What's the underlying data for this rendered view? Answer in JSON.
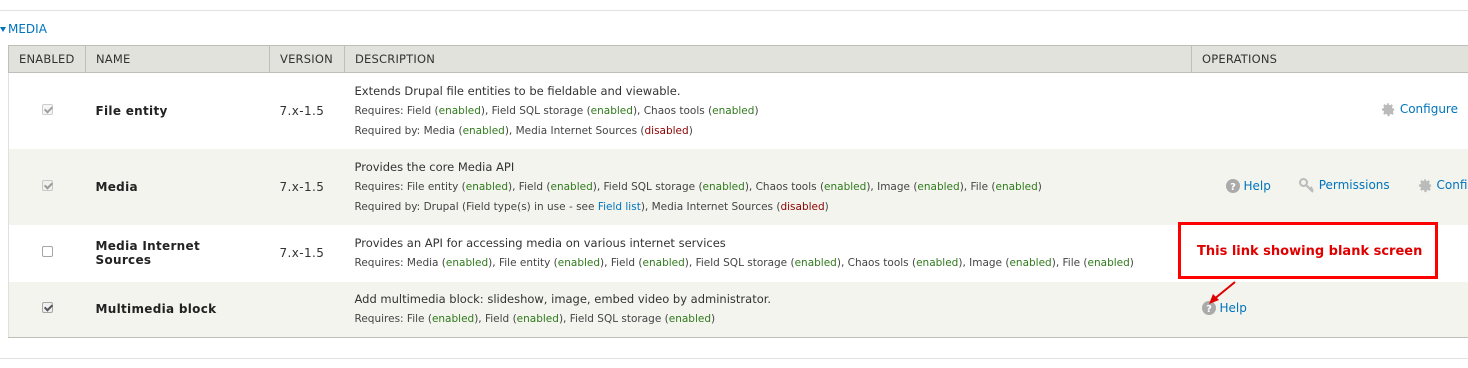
{
  "fieldset": {
    "legend": "MEDIA"
  },
  "headers": {
    "enabled": "ENABLED",
    "name": "NAME",
    "version": "VERSION",
    "description": "DESCRIPTION",
    "operations": "OPERATIONS"
  },
  "rows": [
    {
      "enabled": true,
      "disabled": true,
      "name": "File entity",
      "version": "7.x-1.5",
      "description": "Extends Drupal file entities to be fieldable and viewable.",
      "requires_label": "Requires:",
      "requires": [
        {
          "name": "Field",
          "status": "enabled"
        },
        {
          "name": "Field SQL storage",
          "status": "enabled"
        },
        {
          "name": "Chaos tools",
          "status": "enabled"
        }
      ],
      "required_by_label": "Required by:",
      "required_by": [
        {
          "name": "Media",
          "status": "enabled"
        },
        {
          "name": "Media Internet Sources",
          "status": "disabled"
        }
      ],
      "ops": {
        "configure": "Configure"
      }
    },
    {
      "enabled": true,
      "disabled": true,
      "name": "Media",
      "version": "7.x-1.5",
      "description": "Provides the core Media API",
      "requires_label": "Requires:",
      "requires": [
        {
          "name": "File entity",
          "status": "enabled"
        },
        {
          "name": "Field",
          "status": "enabled"
        },
        {
          "name": "Field SQL storage",
          "status": "enabled"
        },
        {
          "name": "Chaos tools",
          "status": "enabled"
        },
        {
          "name": "Image",
          "status": "enabled"
        },
        {
          "name": "File",
          "status": "enabled"
        }
      ],
      "required_by_label": "Required by:",
      "required_by_drupal": "Drupal (Field type(s) in use - see",
      "field_list_link": "Field list",
      "required_by_rest": "Media Internet Sources",
      "required_by_rest_status": "disabled",
      "ops": {
        "help": "Help",
        "permissions": "Permissions",
        "configure": "Configure"
      }
    },
    {
      "enabled": false,
      "disabled": false,
      "name": "Media Internet Sources",
      "version": "7.x-1.5",
      "description": "Provides an API for accessing media on various internet services",
      "requires_label": "Requires:",
      "requires": [
        {
          "name": "Media",
          "status": "enabled"
        },
        {
          "name": "File entity",
          "status": "enabled"
        },
        {
          "name": "Field",
          "status": "enabled"
        },
        {
          "name": "Field SQL storage",
          "status": "enabled"
        },
        {
          "name": "Chaos tools",
          "status": "enabled"
        },
        {
          "name": "Image",
          "status": "enabled"
        },
        {
          "name": "File",
          "status": "enabled"
        }
      ]
    },
    {
      "enabled": true,
      "disabled": false,
      "name": "Multimedia block",
      "version": "",
      "description": "Add multimedia block: slideshow, image, embed video by administrator.",
      "requires_label": "Requires:",
      "requires": [
        {
          "name": "File",
          "status": "enabled"
        },
        {
          "name": "Field",
          "status": "enabled"
        },
        {
          "name": "Field SQL storage",
          "status": "enabled"
        }
      ],
      "ops": {
        "help": "Help"
      }
    }
  ],
  "annotation": {
    "text": "This link showing blank screen",
    "color": "#e00000"
  },
  "colors": {
    "link": "#0074bd",
    "enabled": "#2f7a1b",
    "disabled": "#8b0000",
    "header_bg": "#e1e2dc",
    "even_row_bg": "#f3f4ee"
  }
}
